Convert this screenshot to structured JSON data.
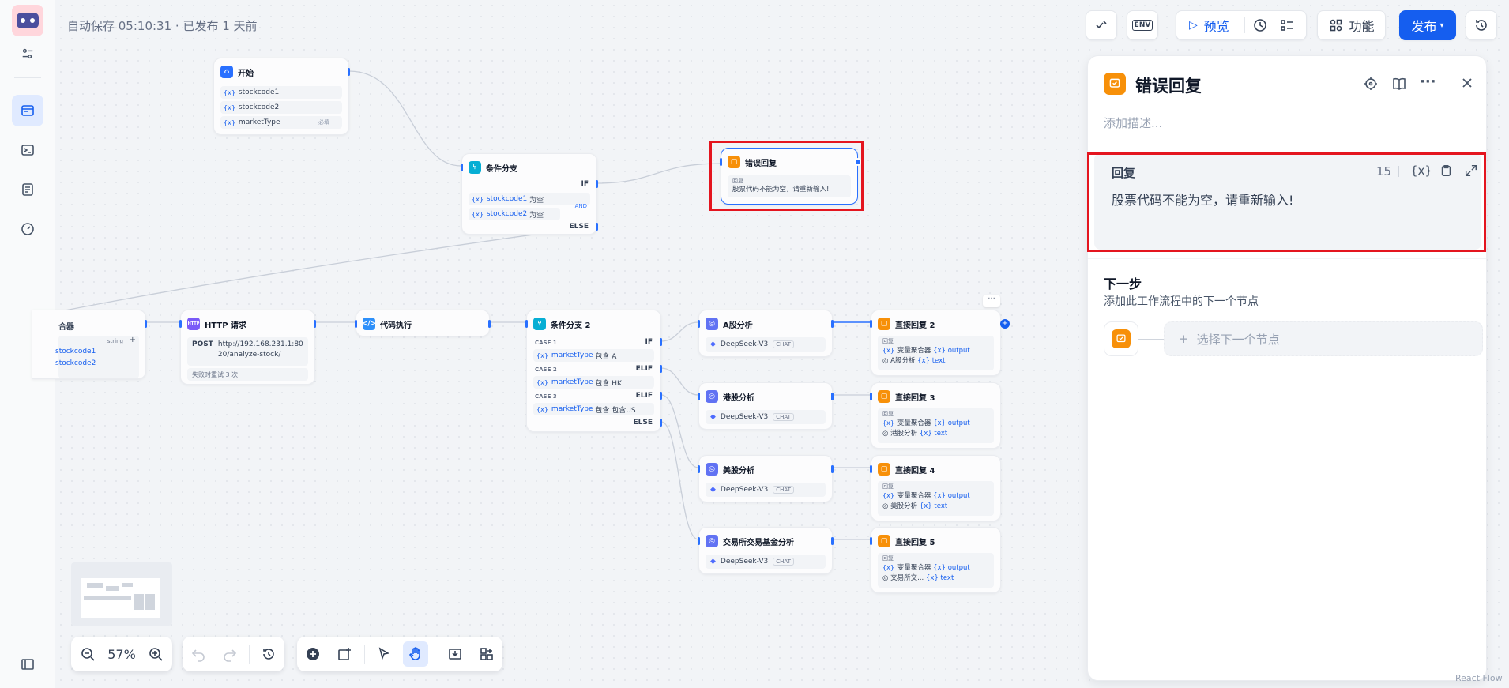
{
  "autosave": "自动保存 05:10:31 · 已发布 1 天前",
  "toolbar": {
    "preview": "预览",
    "features": "功能",
    "publish": "发布"
  },
  "nodes": {
    "start": {
      "title": "开始",
      "vars": [
        "stockcode1",
        "stockcode2",
        "marketType"
      ],
      "var3_tag": "必填"
    },
    "if1": {
      "title": "条件分支",
      "if": "IF",
      "cond1_var": "stockcode1",
      "cond1_op": "为空",
      "cond2_var": "stockcode2",
      "cond2_op": "为空",
      "and": "AND",
      "else": "ELSE"
    },
    "error": {
      "title": "错误回复",
      "reply_label": "回复",
      "reply_text": "股票代码不能为空，请重新输入!"
    },
    "aggregator": {
      "title": "合器",
      "type": "string",
      "vars": [
        "stockcode1",
        "stockcode2"
      ]
    },
    "http": {
      "title": "HTTP 请求",
      "method": "POST",
      "url": "http://192.168.231.1:8020/analyze-stock/",
      "retry": "失败时重试 3 次"
    },
    "code": {
      "title": "代码执行"
    },
    "if2": {
      "title": "条件分支 2",
      "case1": "CASE 1",
      "case2": "CASE 2",
      "case3": "CASE 3",
      "if": "IF",
      "elif": "ELIF",
      "else": "ELSE",
      "var": "marketType",
      "cond1": "包含 A",
      "cond2": "包含 HK",
      "cond3": "包含 包含US"
    },
    "llm": [
      {
        "title": "A股分析",
        "model": "DeepSeek-V3",
        "tag": "CHAT"
      },
      {
        "title": "港股分析",
        "model": "DeepSeek-V3",
        "tag": "CHAT"
      },
      {
        "title": "美股分析",
        "model": "DeepSeek-V3",
        "tag": "CHAT"
      },
      {
        "title": "交易所交易基金分析",
        "model": "DeepSeek-V3",
        "tag": "CHAT"
      }
    ],
    "answers": [
      {
        "title": "直接回复 2",
        "label": "回复",
        "line1_a": "变量聚合器",
        "line1_b": "output",
        "line2_a": "A股分析",
        "line2_b": "text"
      },
      {
        "title": "直接回复 3",
        "label": "回复",
        "line1_a": "变量聚合器",
        "line1_b": "output",
        "line2_a": "港股分析",
        "line2_b": "text"
      },
      {
        "title": "直接回复 4",
        "label": "回复",
        "line1_a": "变量聚合器",
        "line1_b": "output",
        "line2_a": "美股分析",
        "line2_b": "text"
      },
      {
        "title": "直接回复 5",
        "label": "回复",
        "line1_a": "变量聚合器",
        "line1_b": "output",
        "line2_a": "交易所交...",
        "line2_b": "text"
      }
    ]
  },
  "panel": {
    "title": "错误回复",
    "desc_placeholder": "添加描述...",
    "reply_label": "回复",
    "char_count": "15",
    "reply_text": "股票代码不能为空，请重新输入!",
    "next_title": "下一步",
    "next_desc": "添加此工作流程中的下一个节点",
    "select_next": "选择下一个节点"
  },
  "zoom": "57%",
  "footer_text": "React Flow",
  "colors": {
    "accent": "#155eef",
    "highlight": "#e4151f",
    "answer_icon": "#f79009"
  }
}
